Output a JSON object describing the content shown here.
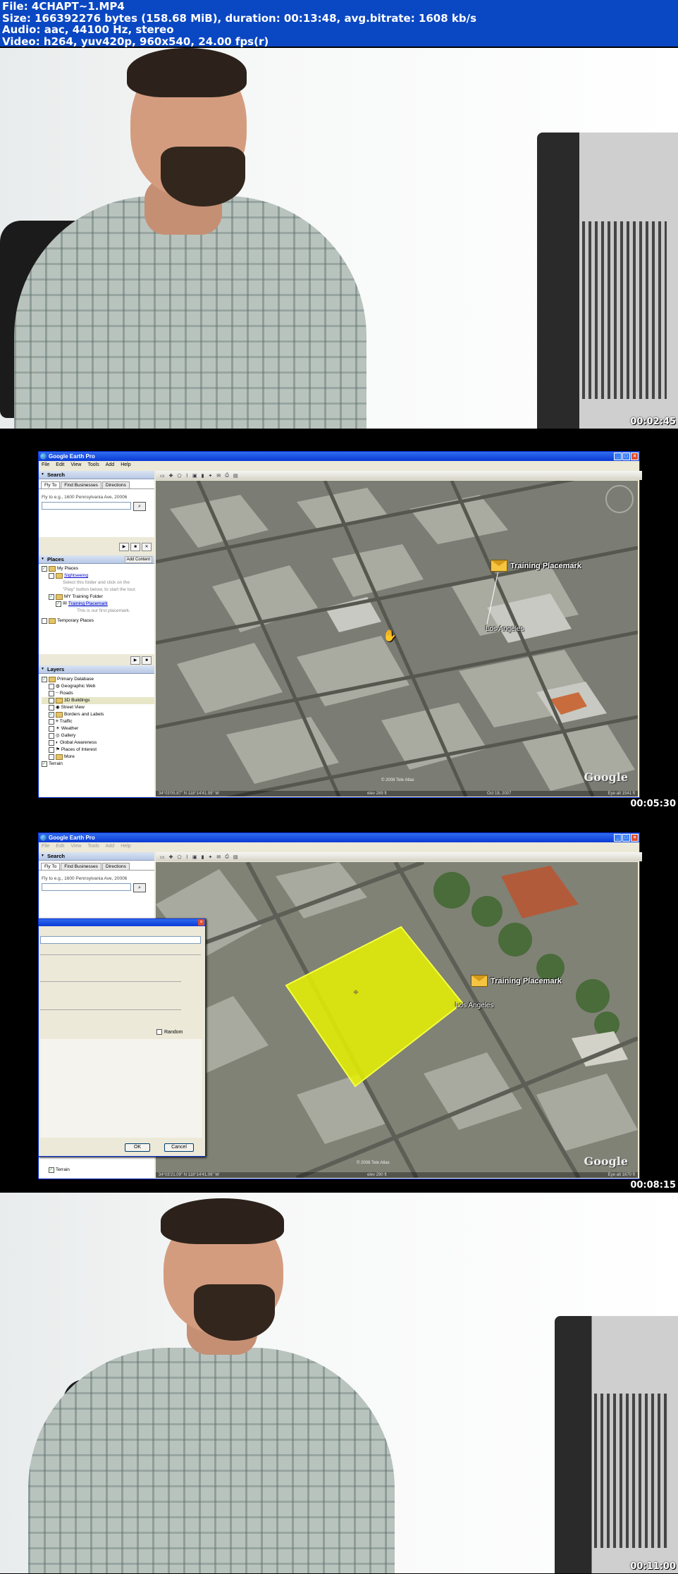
{
  "info": {
    "file": "File: 4CHAPT~1.MP4",
    "size": "Size: 166392276 bytes (158.68 MiB), duration: 00:13:48, avg.bitrate: 1608 kb/s",
    "audio": "Audio: aac, 44100 Hz, stereo",
    "video": "Video: h264, yuv420p, 960x540, 24.00 fps(r)"
  },
  "frames": [
    {
      "timestamp": "00:02:45"
    },
    {
      "timestamp": "00:05:30",
      "window_title": "Google Earth Pro",
      "menu": [
        "File",
        "Edit",
        "View",
        "Tools",
        "Add",
        "Help"
      ],
      "search_label": "Search",
      "tabs": [
        "Fly To",
        "Find Businesses",
        "Directions"
      ],
      "fly_prompt": "Fly to e.g., 1600 Pennsylvania Ave, 20006",
      "places_label": "Places",
      "add_content": "Add Content",
      "places": [
        "My Places",
        "Sightseeing",
        "Select this folder and click on the",
        "\"Play\" button below, to start the tour.",
        "MY Training Folder",
        "Training Placemark",
        "This is our first placemark.",
        "Temporary Places"
      ],
      "layers_label": "Layers",
      "layers": [
        "Primary Database",
        "Geographic Web",
        "Roads",
        "3D Buildings",
        "Street View",
        "Borders and Labels",
        "Traffic",
        "Weather",
        "Gallery",
        "Global Awareness",
        "Places of Interest",
        "More",
        "Terrain"
      ],
      "placemark": "Training Placemark",
      "city": "Los Angeles",
      "status_left": "34°03'05.87\" N   118°14'41.99\" W",
      "status_mid": "elev  289 ft",
      "status_date": "Oct 18, 2007",
      "status_right": "Eye alt  1541 ft",
      "copyright": "© 2008 Tele Atlas",
      "logo": "Google"
    },
    {
      "timestamp": "00:08:15",
      "window_title": "Google Earth Pro",
      "menu": [
        "File",
        "Edit",
        "View",
        "Tools",
        "Add",
        "Help"
      ],
      "search_label": "Search",
      "tabs": [
        "Fly To",
        "Find Businesses",
        "Directions"
      ],
      "fly_prompt": "Fly to e.g., 1600 Pennsylvania Ave, 20006",
      "random_label": "Random",
      "ok": "OK",
      "cancel": "Cancel",
      "layers_tail": [
        "Terrain"
      ],
      "placemark": "Training Placemark",
      "city": "Los Angeles",
      "status_left": "34°03'21.09\" N   118°14'41.06\" W",
      "status_mid": "elev  290 ft",
      "status_right": "Eye alt  1670 ft",
      "copyright": "© 2008 Tele Atlas",
      "logo": "Google"
    },
    {
      "timestamp": "00:11:00"
    }
  ],
  "colors": {
    "header_bg": "#0a47c2",
    "polygon": "#e8f200",
    "xp_title": "#0a3bd6"
  }
}
